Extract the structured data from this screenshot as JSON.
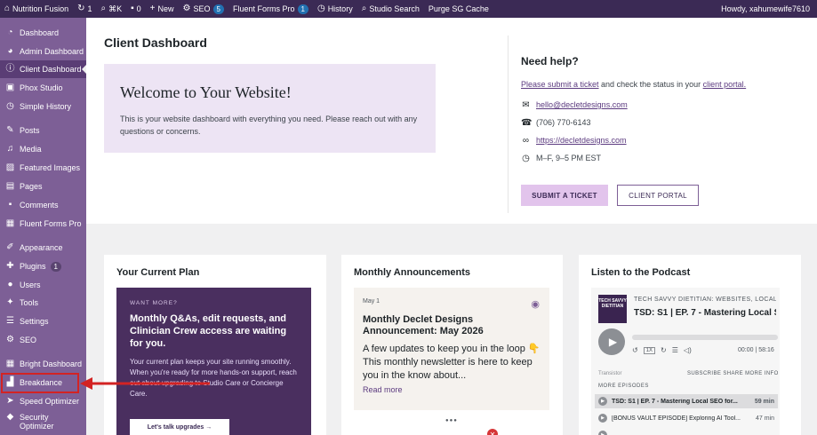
{
  "adminbar": {
    "site_name": "Nutrition Fusion",
    "updates_count": "1",
    "shortcut": "⌘K",
    "comments_count": "0",
    "new_label": "New",
    "seo_label": "SEO",
    "seo_badge": "5",
    "forms_label": "Fluent Forms Pro",
    "forms_badge": "1",
    "history_label": "History",
    "studio_search": "Studio Search",
    "purge_label": "Purge SG Cache",
    "howdy": "Howdy, xahumewife7610"
  },
  "sidebar": {
    "items": [
      {
        "label": "Dashboard",
        "icon": "dashboard-icon"
      },
      {
        "label": "Admin Dashboard",
        "icon": "gauge-icon"
      },
      {
        "label": "Client Dashboard",
        "icon": "info-icon"
      },
      {
        "label": "Phox Studio",
        "icon": "studio-icon"
      },
      {
        "label": "Simple History",
        "icon": "history-icon"
      },
      {
        "label": "Posts",
        "icon": "pin-icon"
      },
      {
        "label": "Media",
        "icon": "media-icon"
      },
      {
        "label": "Featured Images",
        "icon": "image-icon"
      },
      {
        "label": "Pages",
        "icon": "page-icon"
      },
      {
        "label": "Comments",
        "icon": "comment-icon"
      },
      {
        "label": "Fluent Forms Pro",
        "icon": "form-icon"
      },
      {
        "label": "Appearance",
        "icon": "brush-icon"
      },
      {
        "label": "Plugins",
        "icon": "plugin-icon",
        "badge": "1"
      },
      {
        "label": "Users",
        "icon": "user-icon"
      },
      {
        "label": "Tools",
        "icon": "wrench-icon"
      },
      {
        "label": "Settings",
        "icon": "settings-icon"
      },
      {
        "label": "SEO",
        "icon": "seo-icon"
      },
      {
        "label": "Bright Dashboard",
        "icon": "grid-icon"
      },
      {
        "label": "Breakdance",
        "icon": "breakdance-icon"
      },
      {
        "label": "Speed Optimizer",
        "icon": "speed-icon"
      },
      {
        "label": "Security Optimizer",
        "icon": "lock-icon"
      }
    ]
  },
  "main": {
    "page_title": "Client Dashboard",
    "welcome_heading": "Welcome to Your Website!",
    "welcome_text": "This is your website dashboard with everything you need. Please reach out with any questions or concerns."
  },
  "help": {
    "title": "Need help?",
    "ticket_link": "Please submit a ticket",
    "line_middle": " and check the status in your ",
    "portal_link": "client portal.",
    "email": "hello@decletdesigns.com",
    "phone": "(706) 770-6143",
    "website": "https://decletdesigns.com",
    "hours": "M–F, 9–5 PM EST",
    "submit_button": "SUBMIT A TICKET",
    "portal_button": "CLIENT PORTAL"
  },
  "plan": {
    "title": "Your Current Plan",
    "eyebrow": "WANT MORE?",
    "heading": "Monthly Q&As, edit requests, and Clinician Crew access are waiting for you.",
    "text": "Your current plan keeps your site running smoothly. When you're ready for more hands-on support, reach out about upgrading to Studio Care or Concierge Care.",
    "button": "Let's talk upgrades →"
  },
  "announcements": {
    "title": "Monthly Announcements",
    "date": "May 1",
    "post_title": "Monthly Declet Designs Announcement: May 2026",
    "excerpt": "A few updates to keep you in the loop 👇 This monthly newsletter is here to keep you in the know about...",
    "read_more": "Read more"
  },
  "podcast": {
    "title": "Listen to the Podcast",
    "art_text": "TECH SAVVY DIETITIAN",
    "show_name": "TECH SAVVY DIETITIAN: WEBSITES, LOCAL SEO",
    "episode_title": "TSD: S1 | EP. 7 - Mastering Local SEO",
    "speed": "1X",
    "time": "00:00 | 58:16",
    "brand": "Transistor",
    "actions": "SUBSCRIBE  SHARE  MORE INFO",
    "more_label": "MORE EPISODES",
    "episodes": [
      {
        "title": "TSD: S1 | EP. 7 - Mastering Local SEO for...",
        "duration": "59 min"
      },
      {
        "title": "[BONUS VAULT EPISODE] Exploring AI Tool...",
        "duration": "47 min"
      },
      {
        "title": "",
        "duration": ""
      }
    ]
  }
}
